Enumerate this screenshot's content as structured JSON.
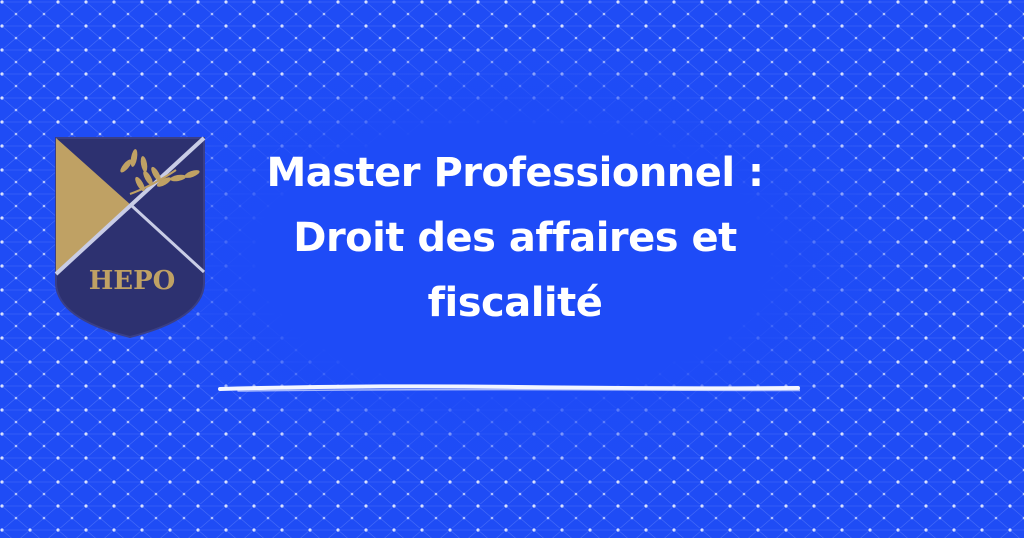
{
  "banner": {
    "logo": {
      "text": "HEPO",
      "icon": "hepo-shield-logo"
    },
    "headline": {
      "line1": "Master Professionnel :",
      "line2": "Droit des affaires et",
      "line3": "fiscalité"
    },
    "colors": {
      "background": "#1f4cf5",
      "shield_navy": "#2d3170",
      "shield_gold": "#bfa164",
      "text": "#ffffff"
    }
  }
}
